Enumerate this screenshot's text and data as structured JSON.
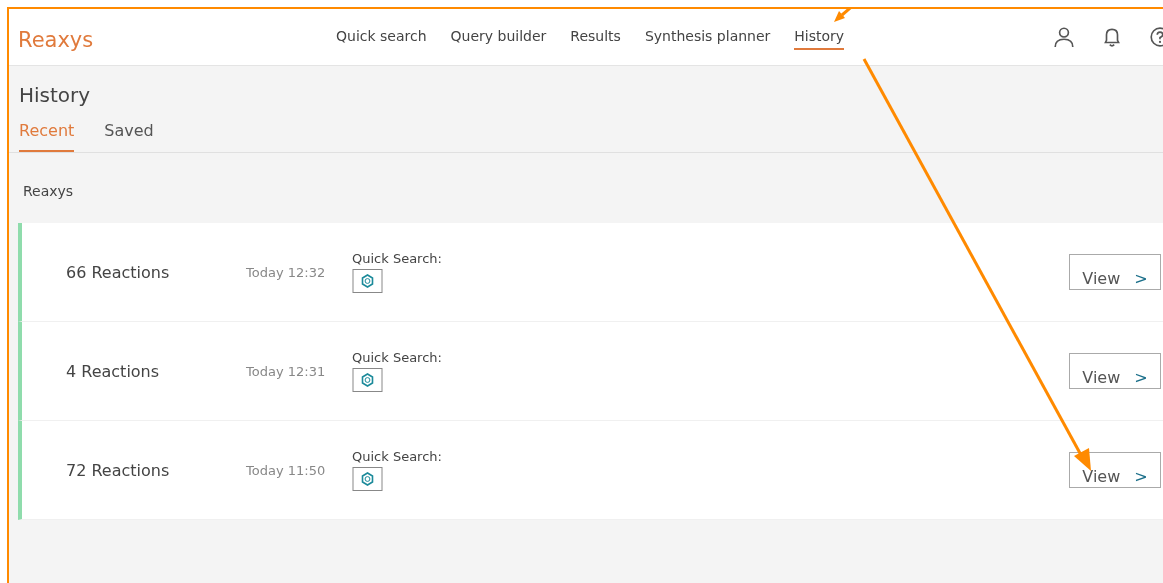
{
  "brand": {
    "name": "Reaxys"
  },
  "nav": [
    {
      "label": "Quick search",
      "selected": false
    },
    {
      "label": "Query builder",
      "selected": false
    },
    {
      "label": "Results",
      "selected": false
    },
    {
      "label": "Synthesis planner",
      "selected": false
    },
    {
      "label": "History",
      "selected": true
    }
  ],
  "page_title": "History",
  "tabs": [
    {
      "label": "Recent",
      "selected": true
    },
    {
      "label": "Saved",
      "selected": false
    }
  ],
  "section_label": "Reaxys",
  "history": [
    {
      "result": "66 Reactions",
      "time": "Today 12:32",
      "query_label": "Quick Search:",
      "button": "View",
      "chevron": ">"
    },
    {
      "result": "4 Reactions",
      "time": "Today 12:31",
      "query_label": "Quick Search:",
      "button": "View",
      "chevron": ">"
    },
    {
      "result": "72 Reactions",
      "time": "Today 11:50",
      "query_label": "Quick Search:",
      "button": "View",
      "chevron": ">"
    }
  ]
}
